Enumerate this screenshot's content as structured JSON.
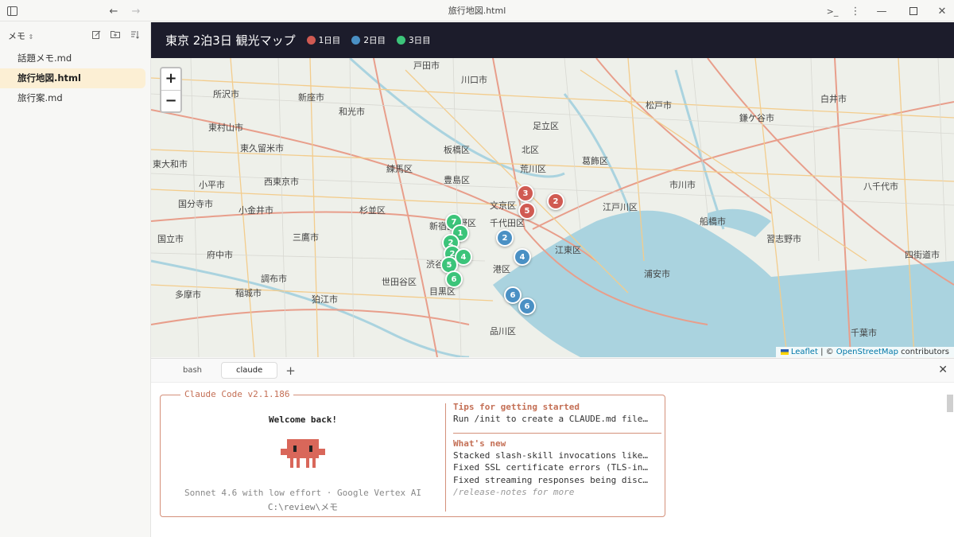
{
  "window": {
    "title": "旅行地図.html"
  },
  "sidebar": {
    "title": "メモ",
    "files": [
      {
        "label": "話題メモ.md"
      },
      {
        "label": "旅行地図.html"
      },
      {
        "label": "旅行案.md"
      }
    ]
  },
  "map": {
    "title": "東京 2泊3日 観光マップ",
    "legend": [
      {
        "label": "1日目",
        "color": "#d05a52"
      },
      {
        "label": "2日目",
        "color": "#4a90c4"
      },
      {
        "label": "3日目",
        "color": "#3cc47a"
      }
    ],
    "zoom_in": "+",
    "zoom_out": "−",
    "attribution": {
      "leaflet": "Leaflet",
      "sep": " | © ",
      "osm": "OpenStreetMap",
      "tail": " contributors"
    },
    "place_labels": [
      "戸田市",
      "川口市",
      "所沢市",
      "新座市",
      "和光市",
      "足立区",
      "松戸市",
      "鎌ケ谷市",
      "白井市",
      "東村山市",
      "東久留米市",
      "板橋区",
      "北区",
      "葛飾区",
      "東大和市",
      "西東京市",
      "練馬区",
      "豊島区",
      "荒川区",
      "市川市",
      "八千代市",
      "小平市",
      "国分寺市",
      "小金井市",
      "杉並区",
      "文京区",
      "千代田区",
      "江戸川区",
      "船橋市",
      "国立市",
      "三鷹市",
      "中野区",
      "新宿区",
      "習志野市",
      "府中市",
      "江東区",
      "四街道市",
      "調布市",
      "渋谷区",
      "港区",
      "世田谷区",
      "浦安市",
      "多摩市",
      "稲城市",
      "狛江市",
      "目黒区",
      "品川区",
      "千葉市"
    ],
    "markers": [
      {
        "day": 1,
        "num": "3"
      },
      {
        "day": 1,
        "num": "2"
      },
      {
        "day": 1,
        "num": "5"
      },
      {
        "day": 2,
        "num": "2"
      },
      {
        "day": 2,
        "num": "4"
      },
      {
        "day": 2,
        "num": "6"
      },
      {
        "day": 2,
        "num": "6"
      },
      {
        "day": 3,
        "num": "7"
      },
      {
        "day": 3,
        "num": "1"
      },
      {
        "day": 3,
        "num": "2"
      },
      {
        "day": 3,
        "num": "2"
      },
      {
        "day": 3,
        "num": "4"
      },
      {
        "day": 3,
        "num": "5"
      },
      {
        "day": 3,
        "num": "6"
      }
    ]
  },
  "terminal": {
    "tabs": [
      {
        "label": "bash"
      },
      {
        "label": "claude"
      }
    ],
    "add": "+",
    "close": "✕",
    "box_title": "Claude Code v2.1.186",
    "welcome": "Welcome back!",
    "model": "Sonnet 4.6 with low effort · Google Vertex AI",
    "path": "C:\\review\\メモ",
    "tips_title": "Tips for getting started",
    "tips": [
      "Run /init to create a CLAUDE.md file…"
    ],
    "whats_new_title": "What's new",
    "whats_new": [
      "Stacked slash-skill invocations like…",
      "Fixed SSL certificate errors (TLS-in…",
      "Fixed streaming responses being disc…"
    ],
    "release_notes": "/release-notes for more"
  }
}
